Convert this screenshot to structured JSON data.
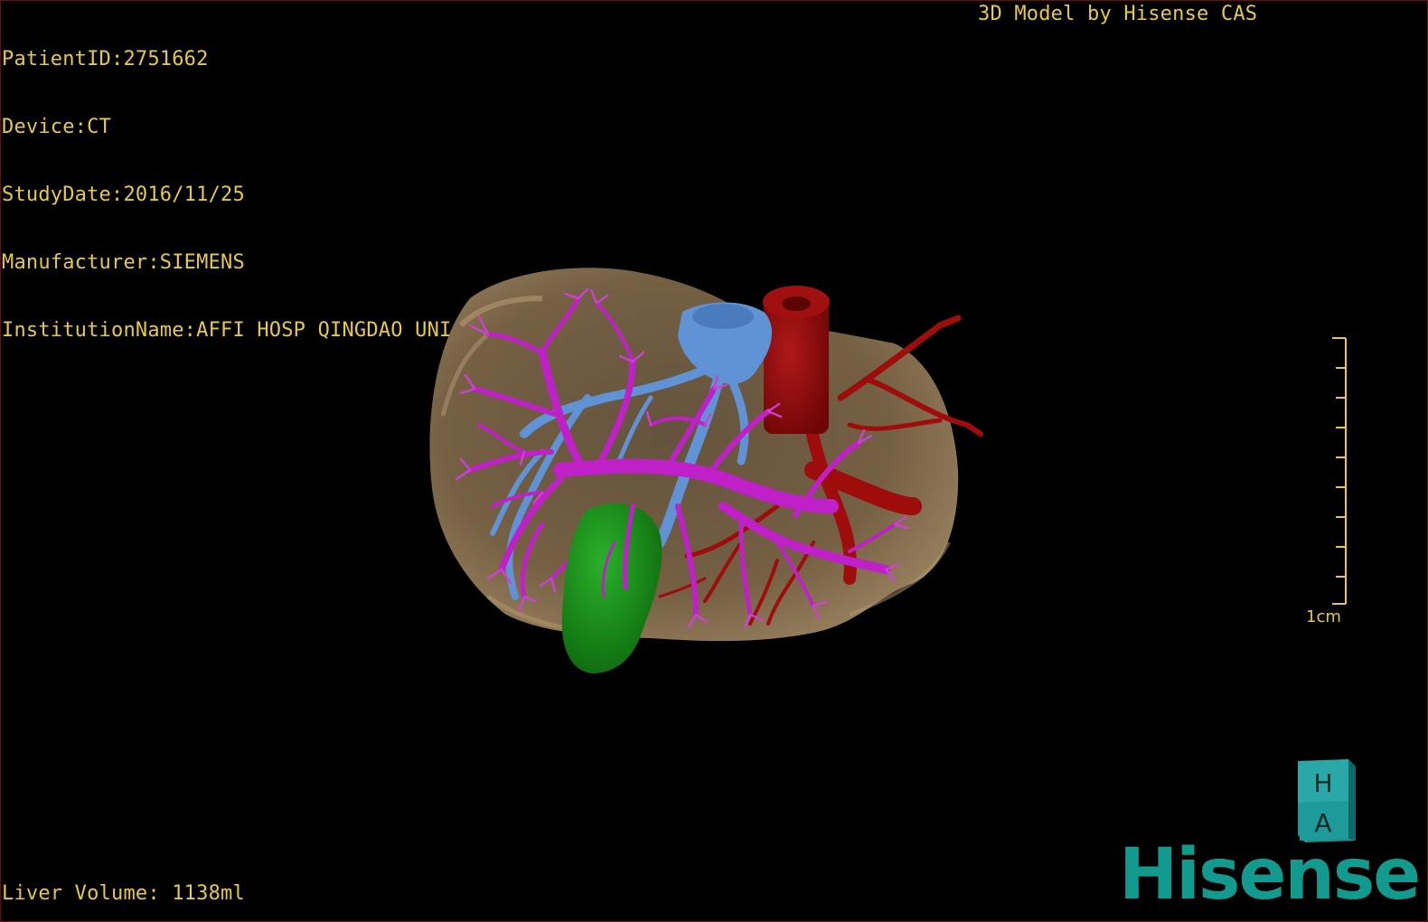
{
  "info": {
    "patient_id": "PatientID:2751662",
    "device": "Device:CT",
    "study_date": "StudyDate:2016/11/25",
    "manufacturer": "Manufacturer:SIEMENS",
    "institution": "InstitutionName:AFFI HOSP QINGDAO UNI"
  },
  "model_label": "3D Model by Hisense CAS",
  "liver_volume": "Liver Volume: 1138ml",
  "scale": {
    "label": "1cm"
  },
  "orientation_cube": {
    "top": "H",
    "front": "A"
  },
  "brand": {
    "name": "Hisense",
    "color": "#139a8e"
  },
  "colors": {
    "text": "#e6c84a",
    "liver": "#8a7050",
    "portal_vein": "#c020c8",
    "hepatic_vein": "#5f93d6",
    "artery": "#9e0c0c",
    "gallbladder": "#1a8a1a"
  }
}
